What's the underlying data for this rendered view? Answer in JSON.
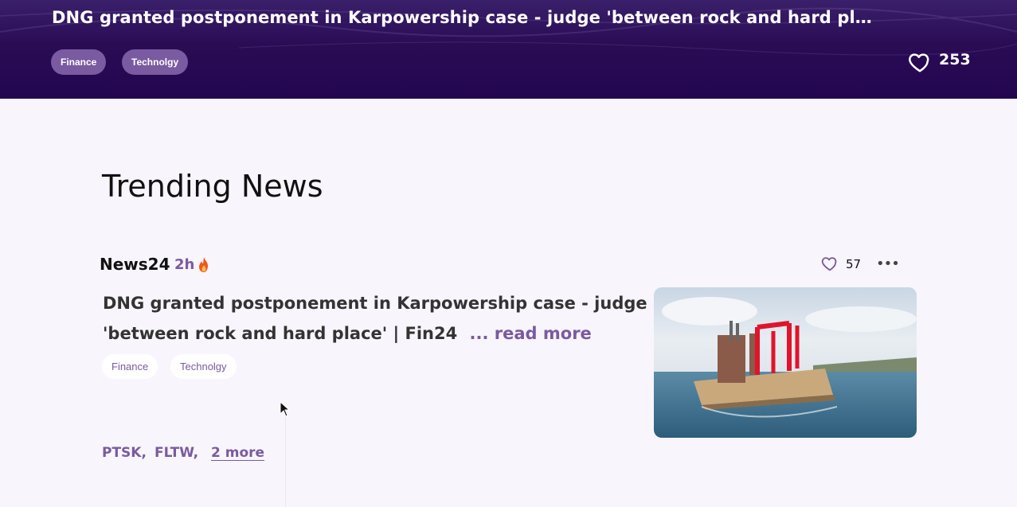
{
  "hero": {
    "title": "DNG granted postponement in Karpowership case - judge 'between rock and hard pla...",
    "tags": [
      "Finance",
      "Technolgy"
    ],
    "likes": "253"
  },
  "section": {
    "title": "Trending News"
  },
  "card": {
    "source": "News24",
    "time": "2h",
    "likes": "57",
    "more_icon": "•••",
    "headline": "DNG granted postponement in Karpowership case - judge 'between rock and hard place' | Fin24",
    "read_more": "... read more",
    "tags": [
      "Finance",
      "Technolgy"
    ],
    "tickers": [
      "PTSK,",
      "FLTW,"
    ],
    "more_tickers": "2 more"
  },
  "colors": {
    "hero_bg": "#230650",
    "accent": "#7a5aa0",
    "page_bg": "#f8f5fc"
  },
  "icons": {
    "hero_like": "heart-outline-icon",
    "card_like": "heart-outline-icon",
    "trending": "fire-icon",
    "more": "more-horizontal-icon",
    "cursor": "mouse-pointer-icon"
  }
}
